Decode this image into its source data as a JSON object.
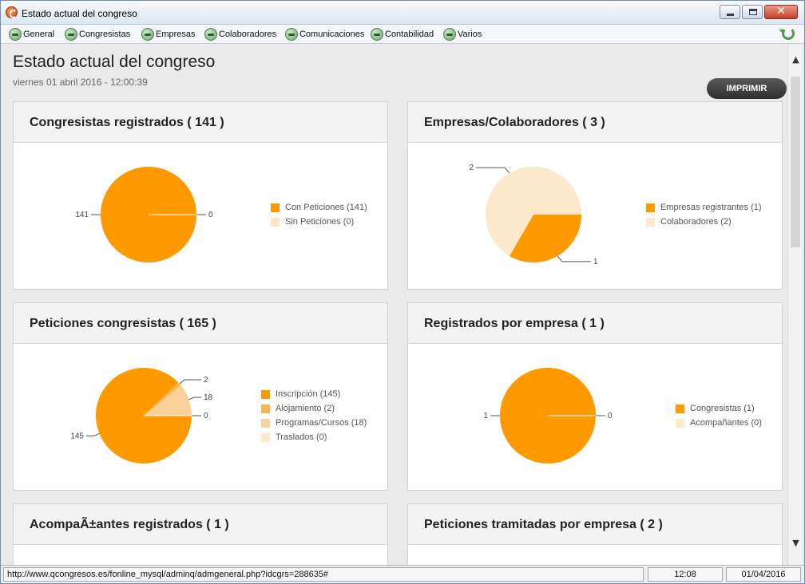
{
  "window": {
    "title": "Estado actual del congreso"
  },
  "menu": [
    {
      "label": "General",
      "icon": "globe-icon"
    },
    {
      "label": "Congresistas",
      "icon": "globe-icon"
    },
    {
      "label": "Empresas",
      "icon": "globe-icon"
    },
    {
      "label": "Colaboradores",
      "icon": "globe-icon"
    },
    {
      "label": "Comunicaciones",
      "icon": "globe-icon"
    },
    {
      "label": "Contabilidad",
      "icon": "globe-icon"
    },
    {
      "label": "Varios",
      "icon": "globe-icon"
    }
  ],
  "page": {
    "title": "Estado actual del congreso",
    "date": "viernes 01 abril 2016 - 12:00:39",
    "print_label": "IMPRIMIR"
  },
  "cards": [
    {
      "title": "Congresistas registrados ( 141 )",
      "slices": [
        {
          "label": "Con Peticiones (141)",
          "value": 141,
          "color": "#ff9900",
          "callout": "141"
        },
        {
          "label": "Sin Peticiones (0)",
          "value": 0,
          "color": "#ffe5c2",
          "callout": "0"
        }
      ]
    },
    {
      "title": "Empresas/Colaboradores ( 3 )",
      "slices": [
        {
          "label": "Empresas registrantes (1)",
          "value": 1,
          "color": "#ff9900",
          "callout": "1"
        },
        {
          "label": "Colaboradores (2)",
          "value": 2,
          "color": "#fde9cc",
          "callout": "2"
        }
      ]
    },
    {
      "title": "Peticiones congresistas ( 165 )",
      "slices": [
        {
          "label": "Inscripción (145)",
          "value": 145,
          "color": "#ff9900",
          "callout": "145"
        },
        {
          "label": "Alojamiento (2)",
          "value": 2,
          "color": "#f8b650",
          "callout": "2"
        },
        {
          "label": "Programas/Cursos (18)",
          "value": 18,
          "color": "#fbd09a",
          "callout": "18"
        },
        {
          "label": "Traslados (0)",
          "value": 0,
          "color": "#fde9cc",
          "callout": "0"
        }
      ]
    },
    {
      "title": "Registrados por empresa ( 1 )",
      "slices": [
        {
          "label": "Congresistas (1)",
          "value": 1,
          "color": "#ff9900",
          "callout": "1"
        },
        {
          "label": "Acompañantes (0)",
          "value": 0,
          "color": "#fde9cc",
          "callout": "0"
        }
      ]
    },
    {
      "title": "AcompaÃ±antes registrados ( 1 )",
      "slices": []
    },
    {
      "title": "Peticiones tramitadas por empresa ( 2 )",
      "slices": []
    }
  ],
  "status": {
    "url": "http://www.qcongresos.es/fonline_mysql/adminq/admgeneral.php?idcgrs=288635#",
    "time": "12:08",
    "date": "01/04/2016"
  },
  "colors": {
    "accent": "#ff9900",
    "print_button": "#3a3a3a"
  }
}
